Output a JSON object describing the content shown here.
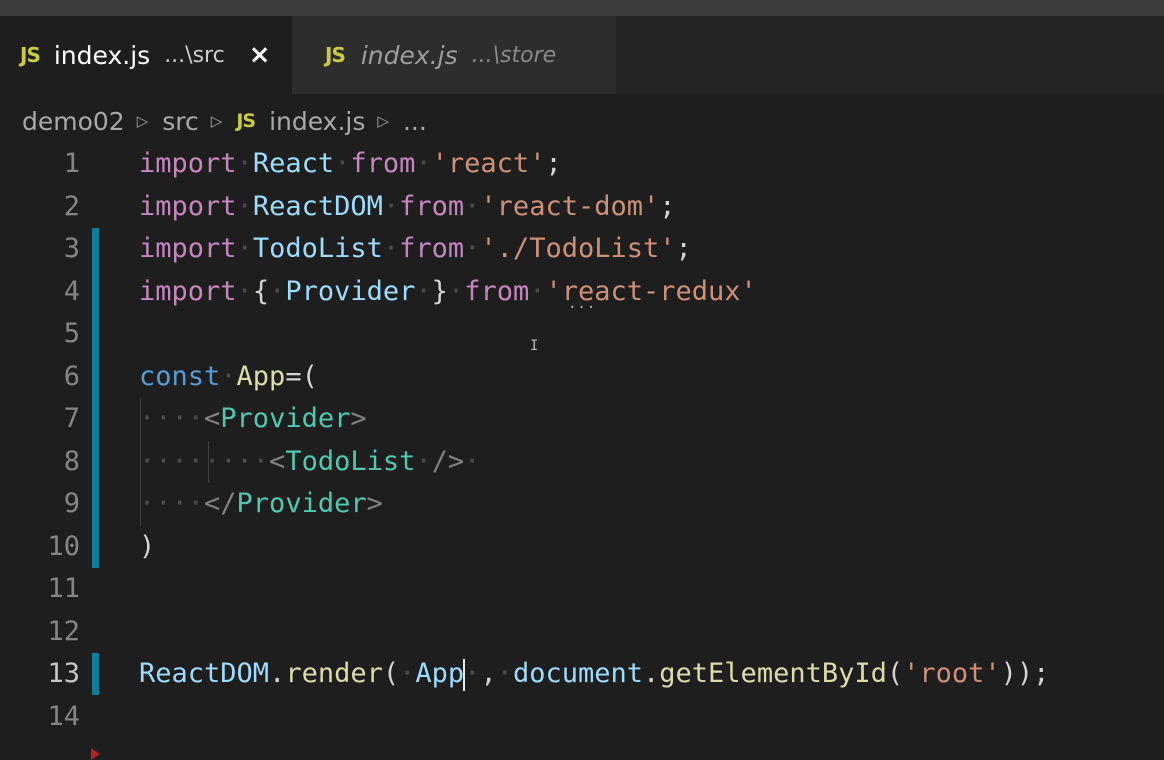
{
  "tabs": [
    {
      "icon": "JS",
      "name": "index.js",
      "path": "...\\src",
      "close": "×"
    },
    {
      "icon": "JS",
      "name": "index.js",
      "path": "...\\store"
    }
  ],
  "breadcrumb": {
    "items": [
      "demo02",
      "src",
      "index.js",
      "..."
    ],
    "icon": "JS"
  },
  "editor": {
    "current_line": 13,
    "line_numbers": [
      "1",
      "2",
      "3",
      "4",
      "5",
      "6",
      "7",
      "8",
      "9",
      "10",
      "11",
      "12",
      "13",
      "14"
    ],
    "lines": {
      "l1": {
        "kw": "import",
        "name": "React",
        "from": "from",
        "str": "'react'",
        "end": ";"
      },
      "l2": {
        "kw": "import",
        "name": "ReactDOM",
        "from": "from",
        "str": "'react-dom'",
        "end": ";"
      },
      "l3": {
        "kw": "import",
        "name": "TodoList",
        "from": "from",
        "str": "'./TodoList'",
        "end": ";"
      },
      "l4": {
        "kw": "import",
        "open": "{",
        "name": "Provider",
        "close": "}",
        "from": "from",
        "str": "'react-redux'"
      },
      "l6": {
        "kw": "const",
        "name": "App",
        "op": "=("
      },
      "l7": {
        "lt": "<",
        "tag": "Provider",
        "gt": ">"
      },
      "l8": {
        "lt": "<",
        "tag": "TodoList",
        "gt": "/>"
      },
      "l9": {
        "lt": "</",
        "tag": "Provider",
        "gt": ">"
      },
      "l10": {
        "paren": ")"
      },
      "l13": {
        "obj": "ReactDOM",
        "dot": ".",
        "method": "render",
        "open": "(",
        "arg1": "App",
        "comma": ",",
        "obj2": "document",
        "dot2": ".",
        "method2": "getElementById",
        "open2": "(",
        "str": "'root'",
        "close": "));"
      }
    }
  },
  "colors": {
    "keyword_import": "#c586c0",
    "keyword_const": "#569cd6",
    "variable": "#9cdcfe",
    "string": "#ce9178",
    "tag": "#4ec9b0",
    "function": "#dcdcaa",
    "gutter_modified": "#0c7d9d"
  },
  "icons": [
    "close-icon",
    "chevron-right-icon",
    "js-file-icon",
    "folding-arrow-icon",
    "text-cursor-icon"
  ]
}
